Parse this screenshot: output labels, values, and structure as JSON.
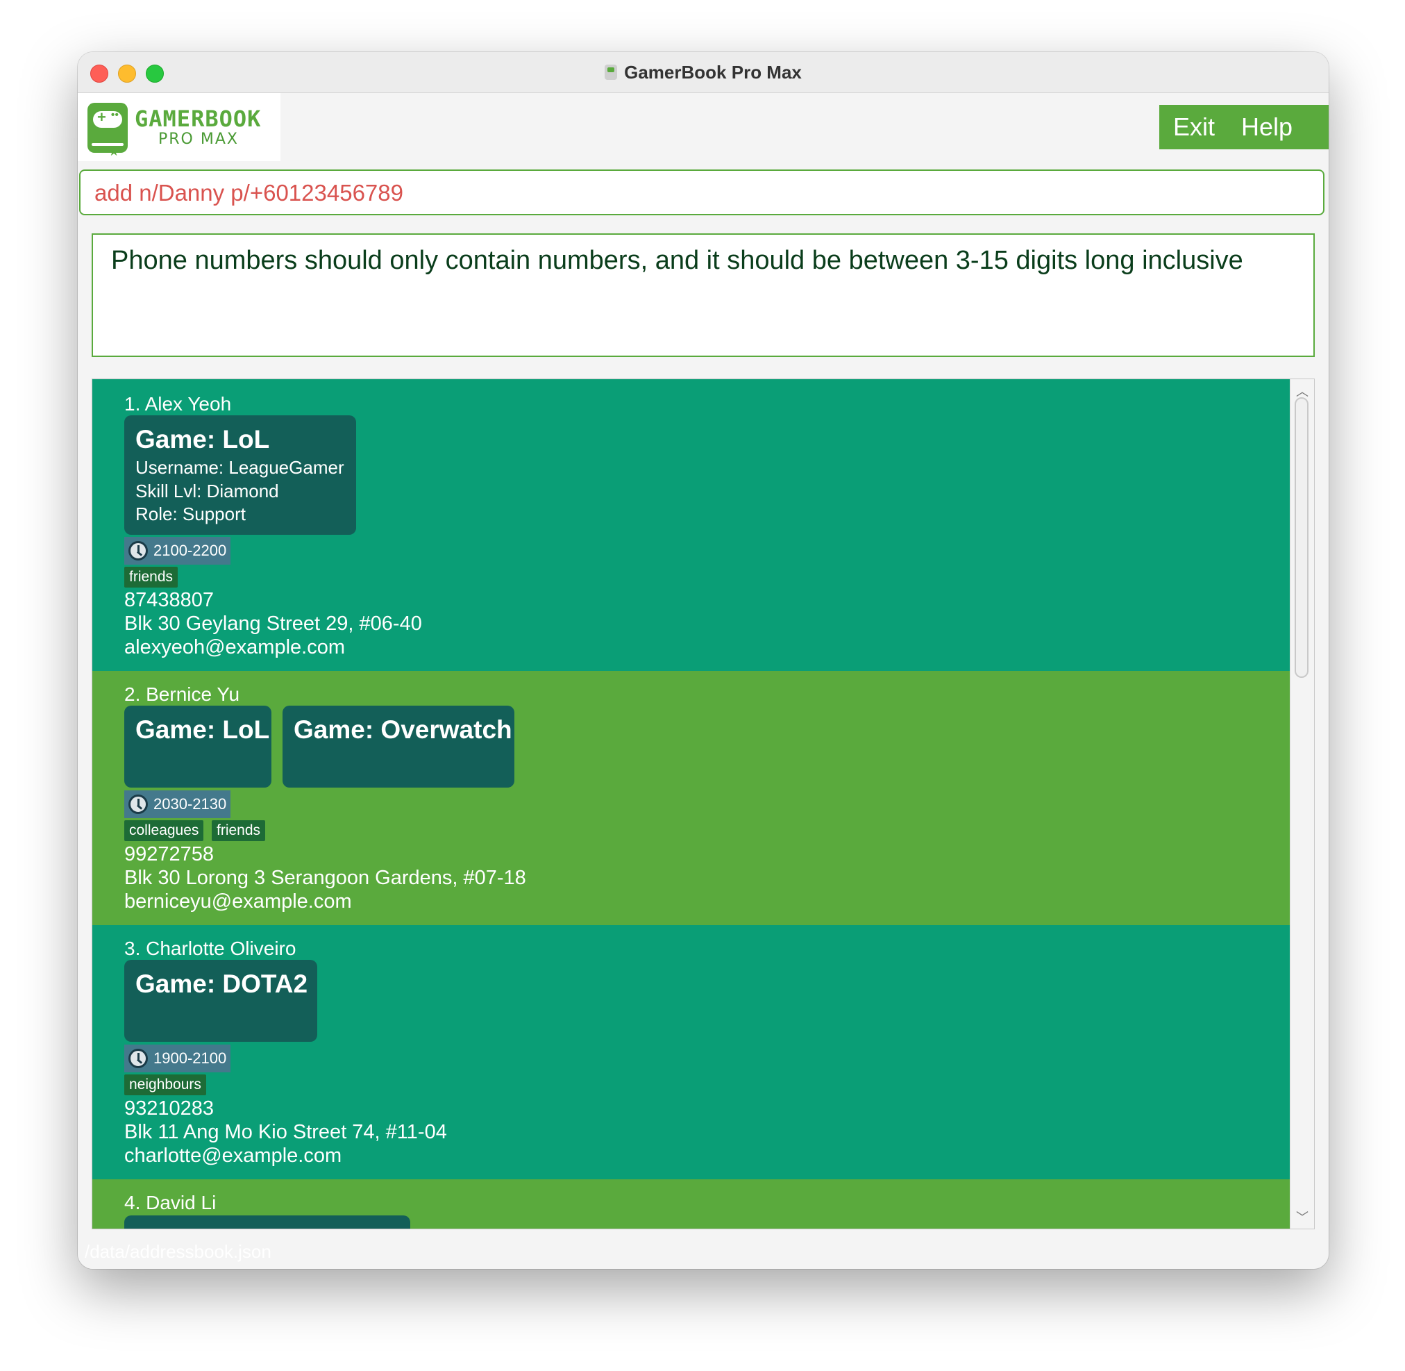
{
  "window": {
    "title": "GamerBook Pro Max"
  },
  "logo": {
    "title": "GAMERBOOK",
    "subtitle": "PRO MAX"
  },
  "menu": {
    "exit": "Exit",
    "help": "Help"
  },
  "command": {
    "value": "add n/Danny p/+60123456789"
  },
  "result": {
    "message": "Phone numbers should only contain numbers, and it should be between 3-15 digits long inclusive"
  },
  "persons": [
    {
      "name": "1. Alex Yeoh",
      "games": [
        {
          "title": "Game: LoL",
          "username": "Username: LeagueGamer",
          "skill": "Skill Lvl: Diamond",
          "role": "Role: Support"
        }
      ],
      "time": "2100-2200",
      "tags": [
        "friends"
      ],
      "phone": "87438807",
      "address": "Blk 30 Geylang Street 29, #06-40",
      "email": "alexyeoh@example.com"
    },
    {
      "name": "2. Bernice Yu",
      "games": [
        {
          "title": "Game: LoL"
        },
        {
          "title": "Game: Overwatch"
        }
      ],
      "time": "2030-2130",
      "tags": [
        "colleagues",
        "friends"
      ],
      "phone": "99272758",
      "address": "Blk 30 Lorong 3 Serangoon Gardens, #07-18",
      "email": "berniceyu@example.com"
    },
    {
      "name": "3. Charlotte Oliveiro",
      "games": [
        {
          "title": "Game: DOTA2"
        }
      ],
      "time": "1900-2100",
      "tags": [
        "neighbours"
      ],
      "phone": "93210283",
      "address": "Blk 11 Ang Mo Kio Street 74, #11-04",
      "email": "charlotte@example.com"
    },
    {
      "name": "4. David Li"
    }
  ],
  "status": {
    "path": "/data/addressbook.json"
  },
  "icons": {
    "time": "clock-icon",
    "scroll_up": "chevron-up-icon",
    "scroll_down": "chevron-down-icon"
  },
  "colors": {
    "accent": "#5aaa3d",
    "card_teal": "#0a9e76",
    "game_box": "#135f58",
    "error_text": "#d9534f"
  }
}
